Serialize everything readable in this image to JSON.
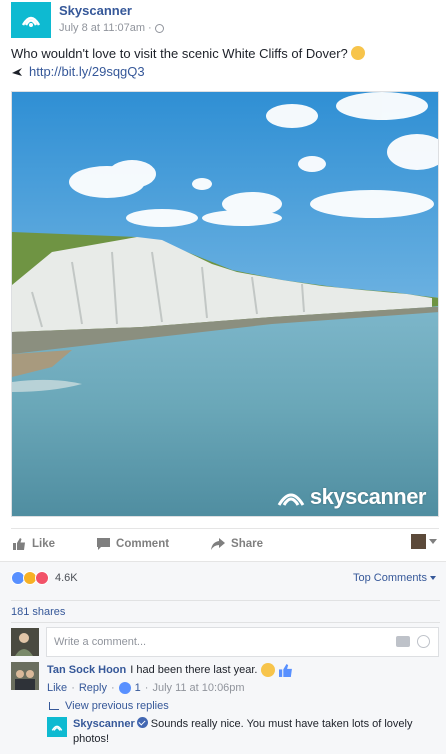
{
  "post": {
    "page_name": "Skyscanner",
    "timestamp": "July 8 at 11:07am",
    "separator": "·",
    "text": "Who wouldn't love to visit the scenic White Cliffs of Dover?",
    "link": "http://bit.ly/29sqgQ3",
    "watermark": "skyscanner",
    "brand_color": "#0ebad1"
  },
  "actions": {
    "like": "Like",
    "comment": "Comment",
    "share": "Share"
  },
  "feedback": {
    "reaction_count": "4.6K",
    "reaction_icons": [
      "like-icon",
      "wow-icon",
      "love-icon"
    ],
    "top_comments": "Top Comments",
    "shares": "181 shares",
    "composer_placeholder": "Write a comment..."
  },
  "comment": {
    "author": "Tan Sock Hoon",
    "text": "I had been there last year.",
    "like": "Like",
    "reply": "Reply",
    "like_count": "1",
    "time": "July 11 at 10:06pm",
    "view_replies": "View previous replies"
  },
  "reply": {
    "author": "Skyscanner",
    "text": "Sounds really nice. You must have taken lots of lovely photos!"
  }
}
